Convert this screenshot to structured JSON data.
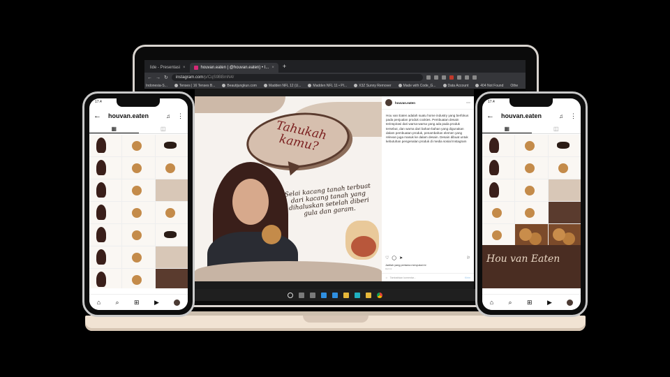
{
  "browser": {
    "tabs": [
      {
        "label": "lide - Presentasi",
        "active": false
      },
      {
        "label": "houvan.eaten | @houvan.eaten) • I...",
        "active": true
      }
    ],
    "new_tab": "+",
    "url_host": "instagram.com",
    "url_path": "/p/CqS9BBmN4/",
    "bookmarks": [
      "Indonesia-S...",
      "Tenses | 16 Tenses B...",
      "Beautijungkun.com",
      "Madden NFL 12 (U...",
      "Madden NFL 11 • PI...",
      "X3Z Sunny Remover",
      "Made with Code_G...",
      "Data Account",
      "404 Not Found",
      "Othe"
    ]
  },
  "post": {
    "bubble_text": "Tahukah kamu?",
    "caption": "Selai kacang tanah terbuat dari kacang tanah yang dihaluskan setelah diberi gula dan garam.",
    "username": "houvan.eaten",
    "description": "Hou van Eaten adalah suatu home industry yang berfokus pada penjualan produk cookies. Pembuatan desain terinspirasi dari warna-warna yang ada pada produk tersebut, dan warna dari bahan-bahan yang digunakan dalam pembuatan produk, penambahan elemen yang relevan juga masuk ke dalam desain. Desain dibuat untuk kebutuhan pengenalan produk di media sosial Instagram",
    "likes": "Jadilah yang pertama menyukai ini",
    "date": "Hari ini",
    "comment_placeholder": "Tambahkan komentar...",
    "post_label": "Kirim"
  },
  "phone_left": {
    "time": "17.4",
    "username": "houvan.eaten"
  },
  "phone_right": {
    "time": "17.4",
    "username": "houvan.eaten",
    "brand": "Hou van Eaten"
  },
  "icons": {
    "back": "←",
    "bell": "🔔",
    "kebab": "⋮",
    "grid": "▦",
    "tagged": "◫",
    "home": "⌂",
    "search": "⌕",
    "add": "⊞",
    "reels": "▶"
  }
}
